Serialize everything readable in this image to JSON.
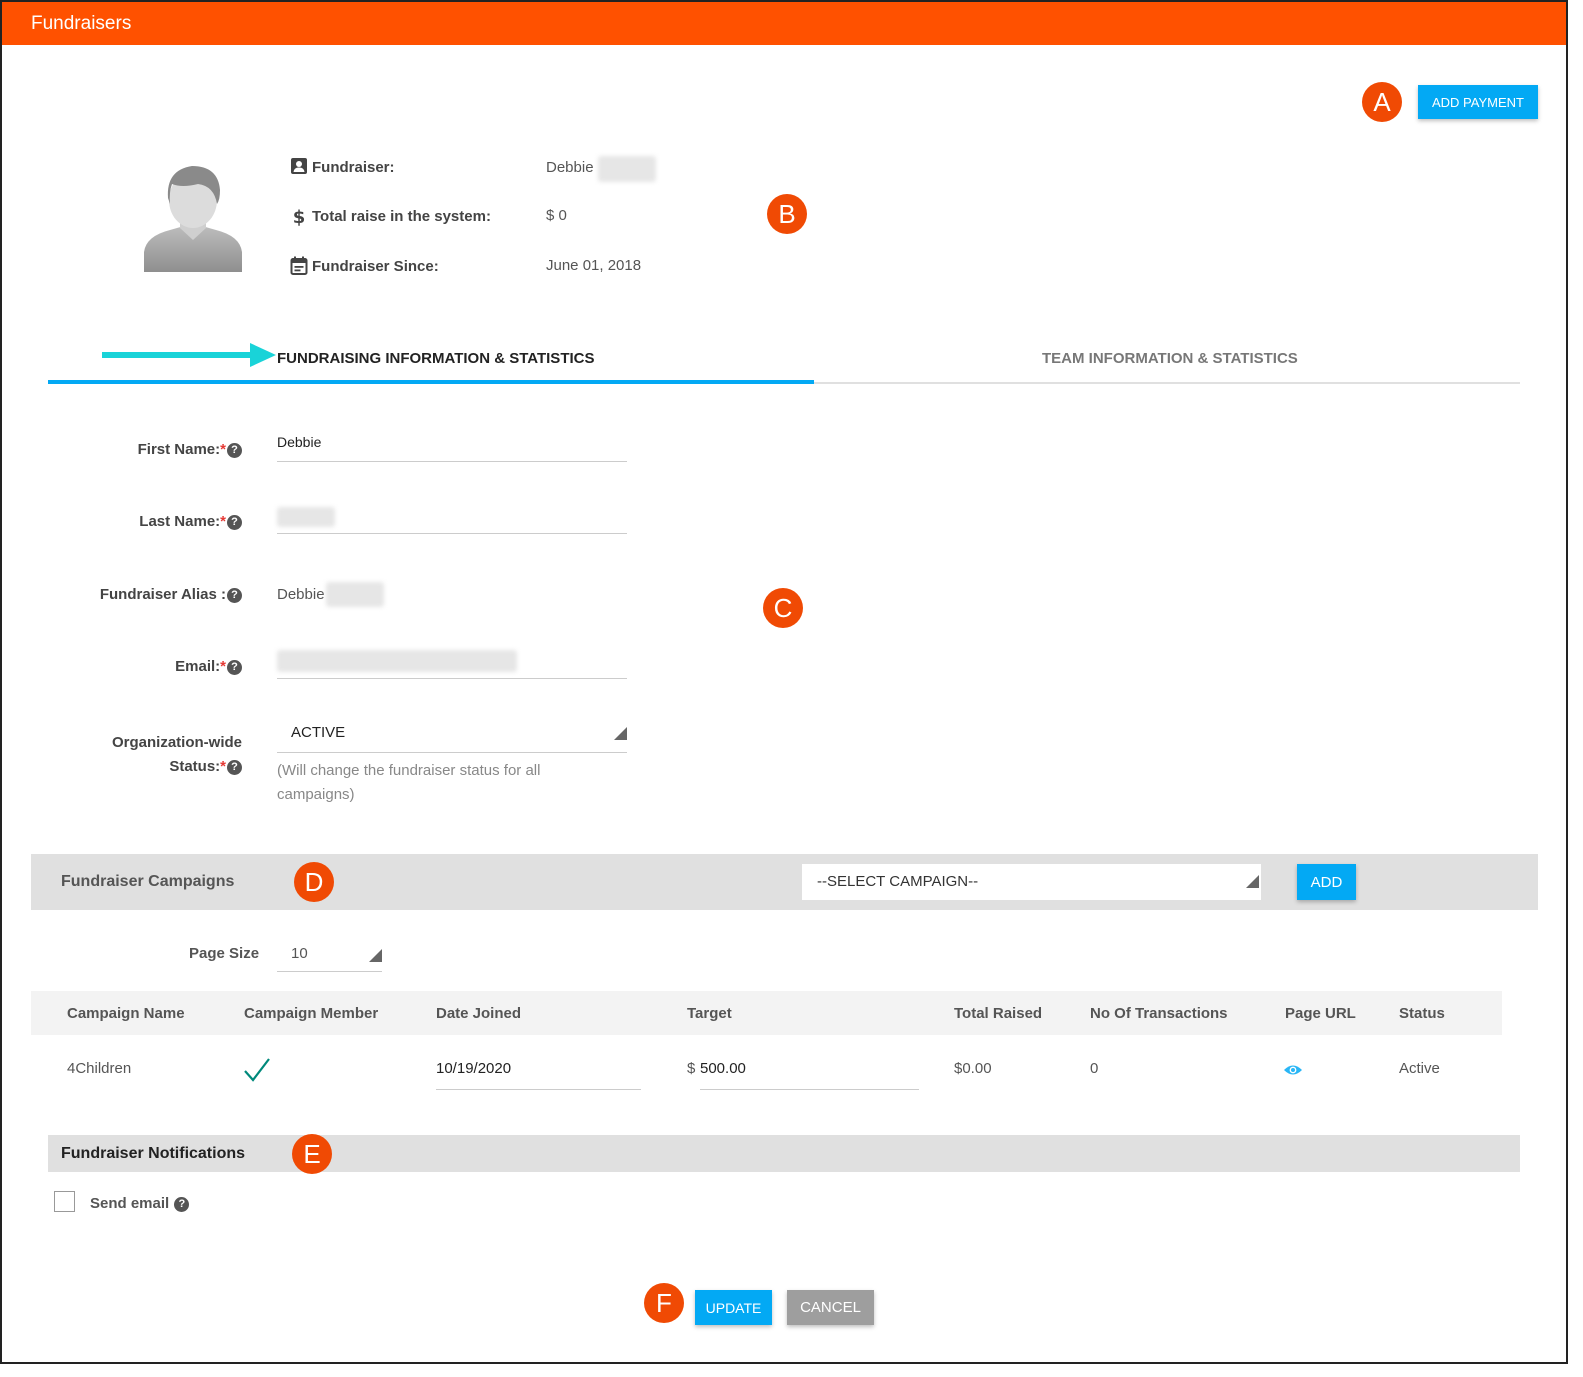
{
  "app": {
    "title": "Fundraisers"
  },
  "header": {
    "add_payment_label": "ADD PAYMENT"
  },
  "callouts": {
    "a": "A",
    "b": "B",
    "c": "C",
    "d": "D",
    "e": "E",
    "f": "F"
  },
  "profile": {
    "fundraiser_label": "Fundraiser:",
    "fundraiser_value": "Debbie",
    "total_label": "Total raise in the system:",
    "total_value": "$ 0",
    "since_label": "Fundraiser Since:",
    "since_value": "June 01, 2018"
  },
  "tabs": [
    {
      "label": "FUNDRAISING INFORMATION & STATISTICS",
      "active": true
    },
    {
      "label": "TEAM INFORMATION & STATISTICS",
      "active": false
    }
  ],
  "form": {
    "first_name_label": "First Name:",
    "first_name_value": "Debbie",
    "last_name_label": "Last Name:",
    "alias_label": "Fundraiser Alias :",
    "alias_value": "Debbie",
    "email_label": "Email:",
    "status_label_line1": "Organization-wide",
    "status_label_line2": "Status:",
    "status_value": "ACTIVE",
    "status_hint": "(Will change the fundraiser status for all campaigns)",
    "required_mark": "*",
    "help_glyph": "?"
  },
  "campaigns": {
    "section_title": "Fundraiser Campaigns",
    "select_placeholder": "--SELECT CAMPAIGN--",
    "add_label": "ADD",
    "page_size_label": "Page Size",
    "page_size_value": "10",
    "columns": [
      "Campaign Name",
      "Campaign Member",
      "Date Joined",
      "Target",
      "Total Raised",
      "No Of Transactions",
      "Page URL",
      "Status"
    ],
    "rows": [
      {
        "campaign_name": "4Children",
        "campaign_member": "✓",
        "date_joined": "10/19/2020",
        "target_currency": "$",
        "target_value": "500.00",
        "total_raised": "$0.00",
        "transactions": "0",
        "status": "Active"
      }
    ]
  },
  "notifications": {
    "section_title": "Fundraiser Notifications",
    "send_email_label": "Send email"
  },
  "footer": {
    "update_label": "UPDATE",
    "cancel_label": "CANCEL"
  },
  "colors": {
    "brand": "#ff5100",
    "accent": "#03a9f4",
    "callout": "#f04a04",
    "arrow": "#19d3d8"
  },
  "icons": {
    "fundraiser": "contact-card-icon",
    "total": "dollar-icon",
    "since": "calendar-icon",
    "page_url": "eye-icon"
  }
}
